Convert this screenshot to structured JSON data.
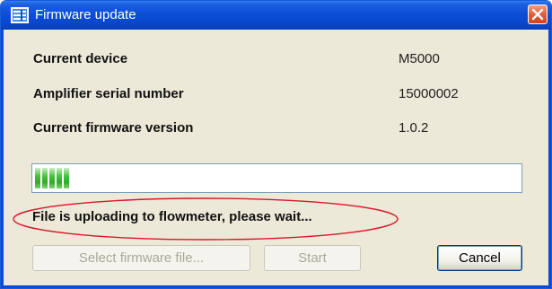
{
  "window": {
    "title": "Firmware update",
    "accent_color": "#0b4dd6",
    "close_color": "#d0411a"
  },
  "info": {
    "rows": [
      {
        "label": "Current device",
        "value": "M5000"
      },
      {
        "label": "Amplifier serial number",
        "value": "15000002"
      },
      {
        "label": "Current firmware version",
        "value": "1.0.2"
      }
    ]
  },
  "progress": {
    "filled_segments": 5,
    "color": "#2fa925"
  },
  "status": {
    "text": "File is uploading to flowmeter, please wait...",
    "highlight_color": "#d9162a"
  },
  "buttons": {
    "select_label": "Select firmware file...",
    "start_label": "Start",
    "cancel_label": "Cancel"
  },
  "icons": {
    "app": "firmware-list-icon",
    "close": "close-x-icon"
  }
}
